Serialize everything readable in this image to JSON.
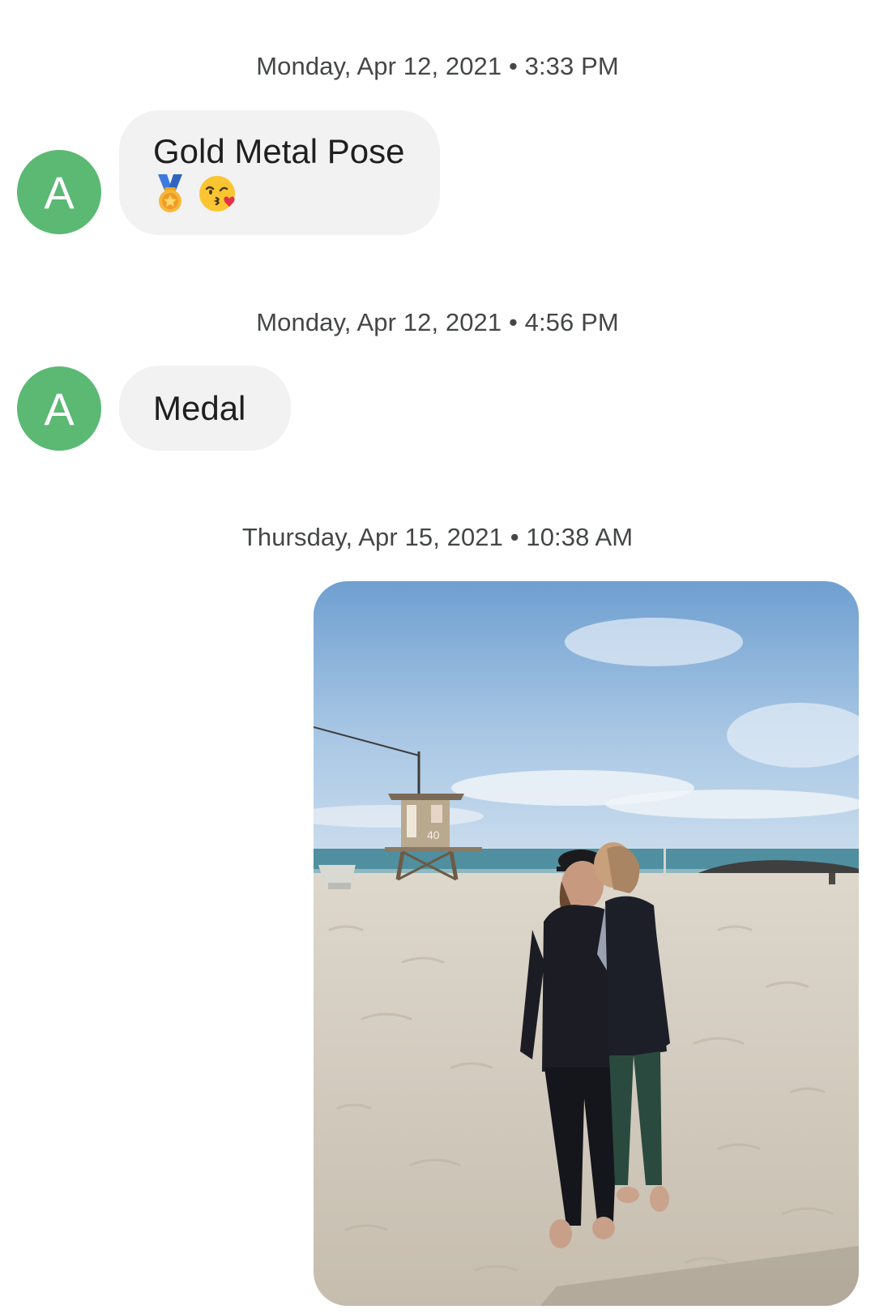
{
  "messages": [
    {
      "timestamp": "Monday, Apr 12, 2021 • 3:33 PM",
      "sender_initial": "A",
      "text": "Gold Metal Pose",
      "emojis": [
        "medal-icon",
        "kissing-face-icon"
      ]
    },
    {
      "timestamp": "Monday, Apr 12, 2021 • 4:56 PM",
      "sender_initial": "A",
      "text": "Medal"
    },
    {
      "timestamp": "Thursday, Apr 15, 2021 • 10:38 AM",
      "attachment": {
        "type": "photo",
        "tower_number": "40"
      }
    }
  ],
  "colors": {
    "avatar": "#5bb974",
    "bubble_incoming": "#f2f2f2",
    "timestamp_text": "#444746",
    "sky_top": "#7fa9d6",
    "sand": "#d6cfc3",
    "ocean": "#4f8fa0"
  }
}
